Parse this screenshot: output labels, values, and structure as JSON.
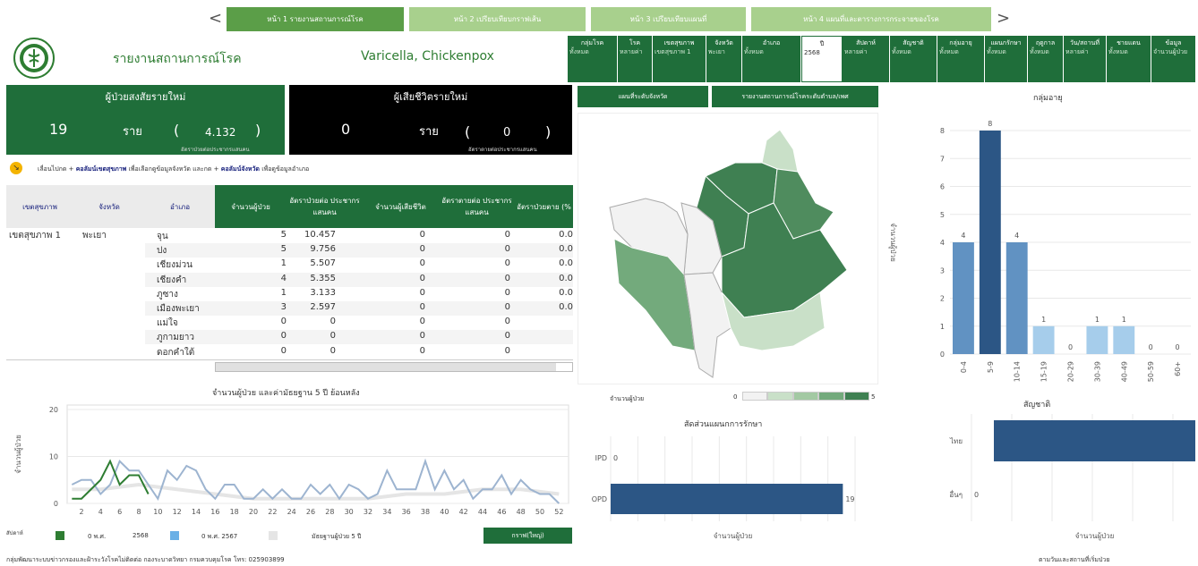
{
  "nav": {
    "prev": "<",
    "next": ">",
    "tabs": [
      "หน้า 1 รายงานสถานการณ์โรค",
      "หน้า 2 เปรียบเทียบกราฟเส้น",
      "หน้า 3 เปรียบเทียบแผนที่",
      "หน้า 4 แผนที่และตารางการกระจายของโรค"
    ]
  },
  "header": {
    "title": "รายงานสถานการณ์โรค",
    "disease": "Varicella, Chickenpox"
  },
  "filters": [
    {
      "label": "กลุ่มโรค",
      "value": "ทั้งหมด"
    },
    {
      "label": "โรค",
      "value": "หลายค่า"
    },
    {
      "label": "เขตสุขภาพ",
      "value": "เขตสุขภาพ 1"
    },
    {
      "label": "จังหวัด",
      "value": "พะเยา"
    },
    {
      "label": "อำเภอ",
      "value": "ทั้งหมด"
    },
    {
      "label": "ปี",
      "value": "2568"
    },
    {
      "label": "สัปดาห์",
      "value": "หลายค่า"
    },
    {
      "label": "สัญชาติ",
      "value": "ทั้งหมด"
    },
    {
      "label": "กลุ่มอายุ",
      "value": "ทั้งหมด"
    },
    {
      "label": "แผนกรักษา",
      "value": "ทั้งหมด"
    },
    {
      "label": "ฤดูกาล",
      "value": "ทั้งหมด"
    },
    {
      "label": "วัน/สถานที่",
      "value": "หลายค่า"
    },
    {
      "label": "ชายแดน",
      "value": "ทั้งหมด"
    },
    {
      "label": "ข้อมูล",
      "value": "จำนวนผู้ป่วย"
    }
  ],
  "cases": {
    "title": "ผู้ป่วยสงสัยรายใหม่",
    "count": "19",
    "unit": "ราย",
    "open": "(",
    "rate": "4.132",
    "close": ")",
    "rate_label": "อัตราป่วยต่อประชากรแสนคน"
  },
  "deaths": {
    "title": "ผู้เสียชีวิตรายใหม่",
    "count": "0",
    "unit": "ราย",
    "open": "(",
    "rate": "0",
    "close": ")",
    "rate_label": "อัตราตายต่อประชากรแสนคน"
  },
  "hint": {
    "pre": "เลื่อนไปกด + ",
    "b1": "คอลัมน์เขตสุขภาพ",
    "mid": " เพื่อเลือกดูข้อมูลจังหวัด และกด + ",
    "b2": "คอลัมน์จังหวัด",
    "post": " เพื่อดูข้อมูลอำเภอ"
  },
  "table": {
    "headers": [
      "เขตสุขภาพ",
      "จังหวัด",
      "อำเภอ",
      "จำนวนผู้ป่วย",
      "อัตราป่วยต่อ ประชากรแสนคน",
      "จำนวนผู้เสียชีวิต",
      "อัตราตายต่อ ประชากรแสนคน",
      "อัตราป่วยตาย (%"
    ],
    "region": "เขตสุขภาพ 1",
    "province": "พะเยา",
    "rows": [
      {
        "d": "จุน",
        "c": "5",
        "r": "10.457",
        "dd": "0",
        "dr": "0",
        "cfr": "0.0"
      },
      {
        "d": "ปง",
        "c": "5",
        "r": "9.756",
        "dd": "0",
        "dr": "0",
        "cfr": "0.0"
      },
      {
        "d": "เชียงม่วน",
        "c": "1",
        "r": "5.507",
        "dd": "0",
        "dr": "0",
        "cfr": "0.0"
      },
      {
        "d": "เชียงคำ",
        "c": "4",
        "r": "5.355",
        "dd": "0",
        "dr": "0",
        "cfr": "0.0"
      },
      {
        "d": "ภูซาง",
        "c": "1",
        "r": "3.133",
        "dd": "0",
        "dr": "0",
        "cfr": "0.0"
      },
      {
        "d": "เมืองพะเยา",
        "c": "3",
        "r": "2.597",
        "dd": "0",
        "dr": "0",
        "cfr": "0.0"
      },
      {
        "d": "แม่ใจ",
        "c": "0",
        "r": "0",
        "dd": "0",
        "dr": "0",
        "cfr": ""
      },
      {
        "d": "ภูกามยาว",
        "c": "0",
        "r": "0",
        "dd": "0",
        "dr": "0",
        "cfr": ""
      },
      {
        "d": "ดอกคำใต้",
        "c": "0",
        "r": "0",
        "dd": "0",
        "dr": "0",
        "cfr": ""
      }
    ]
  },
  "map": {
    "btn1": "แผนที่ระดับจังหวัด",
    "btn2": "รายงานสถานการณ์โรคระดับตำบล/เพศ",
    "legend_label": "จำนวนผู้ป่วย",
    "legend_min": "0",
    "legend_max": "5",
    "colors": [
      "#f2f2f2",
      "#c9e0c8",
      "#a3c9a3",
      "#73aa7c",
      "#3f8052"
    ]
  },
  "weekly_title": "จำนวนผู้ป่วย และค่ามัธยฐาน 5 ปี ย้อนหลัง",
  "weekly_legend": {
    "week_label": "สัปดาห์",
    "l1a": "0 พ.ศ.",
    "l1b": "2568",
    "l2a": "0 พ.ศ. 2567",
    "l3": "มัธยฐานผู้ป่วย 5 ปี",
    "btn": "กราฟ(ใหญ่)"
  },
  "treatment_title": "สัดส่วนแผนกการรักษา",
  "age_title": "กลุ่มอายุ",
  "nation_title": "สัญชาติ",
  "footer": {
    "left": "กลุ่มพัฒนาระบบข่าวกรองและฝ้าระวังโรคไม่ติดต่อ  กองระบาดวิทยา  กรมควบคุมโรค  โทร: 025903899",
    "right": "ตามวันและสถานที่เริ่มป่วย"
  },
  "chart_data": [
    {
      "type": "line",
      "title": "จำนวนผู้ป่วย และค่ามัธยฐาน 5 ปี ย้อนหลัง",
      "ylabel": "จำนวนผู้ป่วย",
      "xlabel": "สัปดาห์",
      "ylim": [
        0,
        20
      ],
      "yticks": [
        0,
        10,
        20
      ],
      "xticks": [
        2,
        4,
        6,
        8,
        10,
        12,
        14,
        16,
        18,
        20,
        22,
        24,
        26,
        28,
        30,
        32,
        34,
        36,
        38,
        40,
        42,
        44,
        46,
        48,
        50,
        52
      ],
      "series": [
        {
          "name": "2568",
          "color": "#2e7d32",
          "x": [
            1,
            2,
            3,
            4,
            5,
            6,
            7,
            8,
            9
          ],
          "values": [
            1,
            1,
            3,
            5,
            9,
            4,
            6,
            6,
            2
          ]
        },
        {
          "name": "2567",
          "color": "#9db4d0",
          "x": [
            1,
            2,
            3,
            4,
            5,
            6,
            7,
            8,
            9,
            10,
            11,
            12,
            13,
            14,
            15,
            16,
            17,
            18,
            19,
            20,
            21,
            22,
            23,
            24,
            25,
            26,
            27,
            28,
            29,
            30,
            31,
            32,
            33,
            34,
            35,
            36,
            37,
            38,
            39,
            40,
            41,
            42,
            43,
            44,
            45,
            46,
            47,
            48,
            49,
            50,
            51,
            52
          ],
          "values": [
            4,
            5,
            5,
            2,
            4,
            9,
            7,
            7,
            4,
            1,
            7,
            5,
            8,
            7,
            3,
            1,
            4,
            4,
            1,
            1,
            3,
            1,
            3,
            1,
            1,
            4,
            2,
            4,
            1,
            4,
            3,
            1,
            2,
            7,
            3,
            3,
            3,
            9,
            3,
            7,
            3,
            5,
            1,
            3,
            3,
            6,
            2,
            5,
            3,
            2,
            2,
            0
          ]
        },
        {
          "name": "มัธยฐานผู้ป่วย 5 ปี",
          "color": "#e5e5e5",
          "x": [
            1,
            4,
            8,
            12,
            16,
            20,
            24,
            28,
            32,
            36,
            40,
            44,
            48,
            52
          ],
          "values": [
            3,
            3,
            4,
            3,
            2,
            1,
            1,
            1,
            1,
            2,
            2,
            3,
            3,
            2
          ]
        }
      ]
    },
    {
      "type": "bar",
      "title": "สัดส่วนแผนกการรักษา",
      "categories": [
        "IPD",
        "OPD"
      ],
      "values": [
        0,
        19
      ],
      "xlabel": "จำนวนผู้ป่วย",
      "orientation": "horizontal"
    },
    {
      "type": "bar",
      "title": "กลุ่มอายุ",
      "categories": [
        "0-4",
        "5-9",
        "10-14",
        "15-19",
        "20-29",
        "30-39",
        "40-49",
        "50-59",
        "60+"
      ],
      "values": [
        4,
        8,
        4,
        1,
        0,
        1,
        1,
        0,
        0
      ],
      "ylabel": "จำนวนผู้ป่วย",
      "ylim": [
        0,
        8
      ],
      "yticks": [
        0,
        1,
        2,
        3,
        4,
        5,
        6,
        7,
        8
      ]
    },
    {
      "type": "bar",
      "title": "สัญชาติ",
      "categories": [
        "ไทย",
        "อื่นๆ"
      ],
      "values": [
        19,
        0
      ],
      "xlabel": "จำนวนผู้ป่วย",
      "orientation": "horizontal"
    }
  ]
}
